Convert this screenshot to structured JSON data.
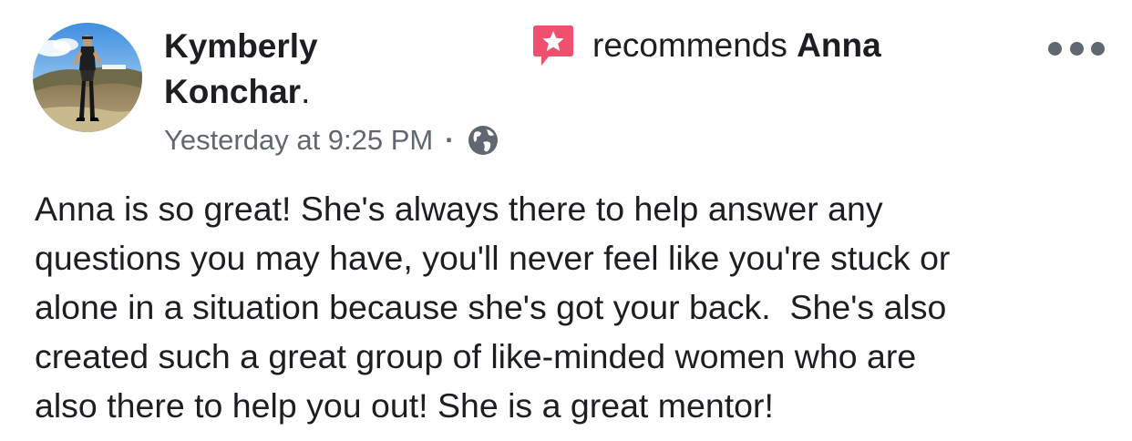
{
  "post": {
    "author": {
      "first_name": "Kymberly",
      "last_name": "Konchar",
      "period": "."
    },
    "recommendation": {
      "verb": "recommends",
      "target": "Anna",
      "icon": "recommendation-star-icon",
      "accent_color": "#f0506e"
    },
    "timestamp": "Yesterday at 9:25 PM",
    "separator": "·",
    "privacy_icon": "globe-icon",
    "more_icon": "more-options-icon",
    "body_lines": [
      "Anna is so great! She's always there to help answer any",
      "questions you may have, you'll never feel like you're stuck or",
      "alone in a situation because she's got your back.  She's also",
      "created such a great group of like-minded women who are",
      "also there to help you out! She is a great mentor!"
    ]
  }
}
